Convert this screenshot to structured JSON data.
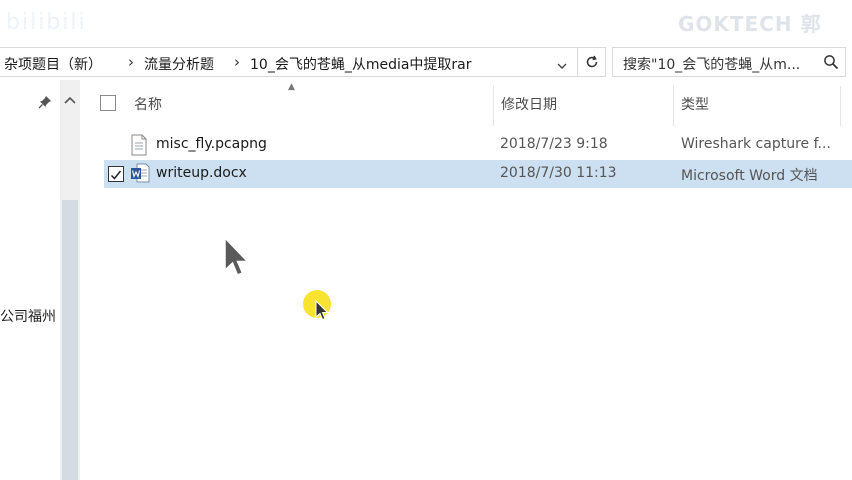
{
  "watermark": {
    "left": "bilibili",
    "right": "GOKTECH 郭"
  },
  "address": {
    "crumbs": [
      "杂项题目（新）",
      "流量分析题",
      "10_会飞的苍蝇_从media中提取rar"
    ],
    "separator": "›",
    "refresh_icon": "refresh-icon"
  },
  "search": {
    "value": "搜索\"10_会飞的苍蝇_从m...",
    "icon": "search-icon"
  },
  "nav": {
    "label": "公司福州"
  },
  "columns": {
    "name": "名称",
    "date": "修改日期",
    "type": "类型"
  },
  "files": [
    {
      "name": "misc_fly.pcapng",
      "date": "2018/7/23 9:18",
      "type": "Wireshark capture f...",
      "icon": "pcap-file-icon",
      "selected": false
    },
    {
      "name": "writeup.docx",
      "date": "2018/7/30 11:13",
      "type": "Microsoft Word 文档",
      "icon": "word-file-icon",
      "selected": true
    }
  ],
  "colors": {
    "selection": "#cce0f2",
    "accent": "#2b579a",
    "highlight": "#f7e11a"
  }
}
